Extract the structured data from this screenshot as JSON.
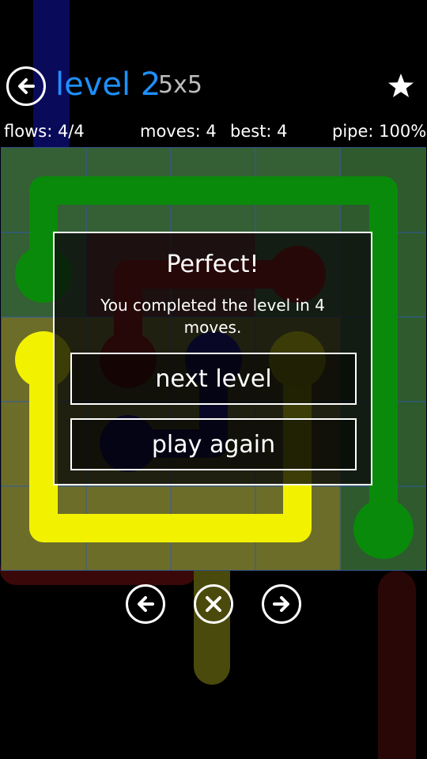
{
  "header": {
    "level_title": "level 2",
    "size": "5x5"
  },
  "stats": {
    "flows": "flows: 4/4",
    "moves": "moves: 4",
    "best": "best: 4",
    "pipe": "pipe: 100%"
  },
  "dialog": {
    "title": "Perfect!",
    "message": "You completed the level in 4 moves.",
    "next_label": "next level",
    "replay_label": "play again"
  },
  "colors": {
    "green": "#0a8a0a",
    "yellow": "#f2f200",
    "red": "#8b0000",
    "blue": "#00008b",
    "title_blue": "#1e90ff"
  },
  "icons": {
    "back": "back-arrow-icon",
    "star": "star-icon",
    "prev": "previous-arrow-icon",
    "restart": "close-x-icon",
    "next": "next-arrow-icon"
  }
}
